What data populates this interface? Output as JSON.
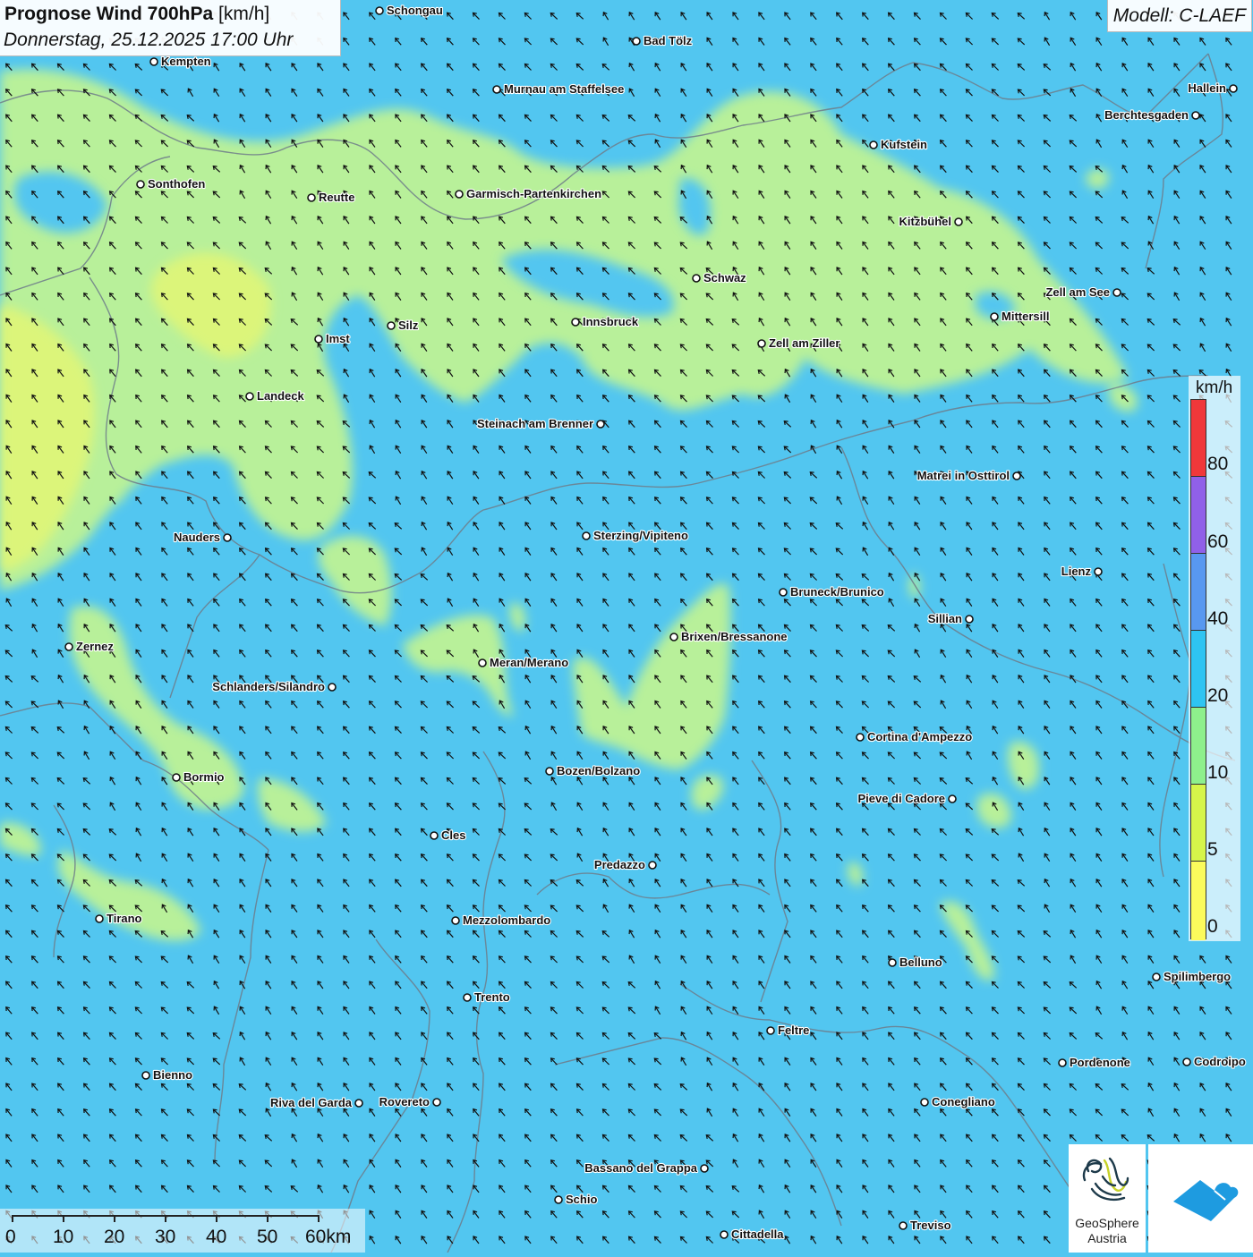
{
  "header": {
    "title_bold": "Prognose Wind 700hPa",
    "title_unit": "[km/h]",
    "datetime": "Donnerstag, 25.12.2025 17:00 Uhr",
    "model": "Modell: C-LAEF"
  },
  "legend": {
    "unit": "km/h",
    "ticks": [
      "80",
      "60",
      "40",
      "20",
      "10",
      "5",
      "0"
    ],
    "colors": [
      "#f0383a",
      "#9060e8",
      "#5898f0",
      "#2ec4f2",
      "#8ef08c",
      "#d6f54a",
      "#fbfb5c"
    ]
  },
  "scale_bar": {
    "labels": [
      "0",
      "10",
      "20",
      "30",
      "40",
      "50",
      "60km"
    ]
  },
  "logos": {
    "geosphere_line1": "GeoSphere",
    "geosphere_line2": "Austria"
  },
  "wind": {
    "dominant_direction": "from south-east",
    "color_calm": "#b8f09a",
    "color_field": "#52c6f0"
  },
  "cities": [
    {
      "name": "Schongau"
    },
    {
      "name": "Bad Tölz"
    },
    {
      "name": "Kempten"
    },
    {
      "name": "Murnau am Staffelsee"
    },
    {
      "name": "Hallein"
    },
    {
      "name": "Berchtesgaden"
    },
    {
      "name": "Kufstein"
    },
    {
      "name": "Sonthofen"
    },
    {
      "name": "Reutte"
    },
    {
      "name": "Garmisch-Partenkirchen"
    },
    {
      "name": "Kitzbühel"
    },
    {
      "name": "Schwaz"
    },
    {
      "name": "Zell am See"
    },
    {
      "name": "Mittersill"
    },
    {
      "name": "Silz"
    },
    {
      "name": "Innsbruck"
    },
    {
      "name": "Imst"
    },
    {
      "name": "Zell am Ziller"
    },
    {
      "name": "Landeck"
    },
    {
      "name": "Steinach am Brenner"
    },
    {
      "name": "Matrei in Osttirol"
    },
    {
      "name": "Nauders"
    },
    {
      "name": "Sterzing/Vipiteno"
    },
    {
      "name": "Lienz"
    },
    {
      "name": "Bruneck/Brunico"
    },
    {
      "name": "Sillian"
    },
    {
      "name": "Brixen/Bressanone"
    },
    {
      "name": "Zernez"
    },
    {
      "name": "Meran/Merano"
    },
    {
      "name": "Schlanders/Silandro"
    },
    {
      "name": "Cortina d'Ampezzo"
    },
    {
      "name": "Bozen/Bolzano"
    },
    {
      "name": "Bormio"
    },
    {
      "name": "Pieve di Cadore"
    },
    {
      "name": "Cles"
    },
    {
      "name": "Predazzo"
    },
    {
      "name": "Tirano"
    },
    {
      "name": "Mezzolombardo"
    },
    {
      "name": "Belluno"
    },
    {
      "name": "Spilimbergo"
    },
    {
      "name": "Trento"
    },
    {
      "name": "Feltre"
    },
    {
      "name": "Pordenone"
    },
    {
      "name": "Codroipo"
    },
    {
      "name": "Bienno"
    },
    {
      "name": "Riva del Garda"
    },
    {
      "name": "Rovereto"
    },
    {
      "name": "Conegliano"
    },
    {
      "name": "Bassano del Grappa"
    },
    {
      "name": "Schio"
    },
    {
      "name": "Treviso"
    },
    {
      "name": "Cittadella"
    }
  ]
}
